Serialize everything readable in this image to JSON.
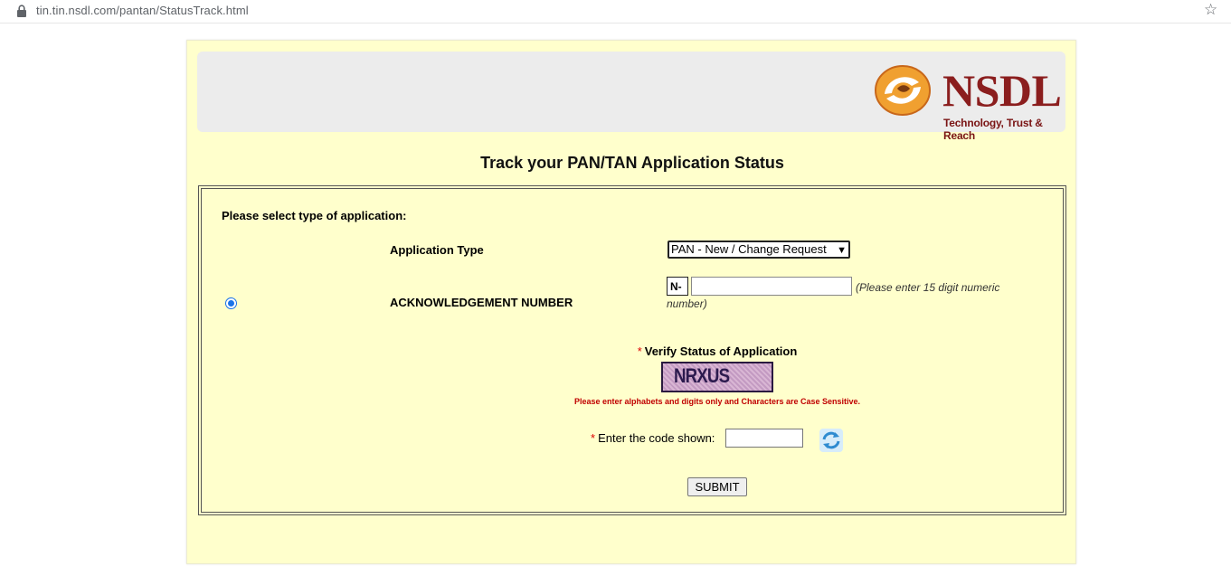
{
  "browser": {
    "url": "tin.tin.nsdl.com/pantan/StatusTrack.html",
    "lock_icon": "lock-icon",
    "star_icon": "star-icon"
  },
  "header": {
    "logo_text": "NSDL",
    "tagline": "Technology, Trust & Reach",
    "logo_icon": "nsdl-logo-mark"
  },
  "page_title": "Track your PAN/TAN Application Status",
  "form": {
    "select_type_label": "Please select type of application:",
    "application_type_label": "Application Type",
    "application_type_value": "PAN - New / Change Request",
    "ack_label": "ACKNOWLEDGEMENT NUMBER",
    "ack_prefix": "N-",
    "ack_value": "",
    "ack_hint": "(Please enter 15 digit numeric number)",
    "radio_selected": true,
    "required_mark": "*",
    "verify_label": "Verify Status of Application",
    "captcha_text": "NRXUS",
    "case_note": "Please enter alphabets and digits only and Characters are Case Sensitive.",
    "code_label": "Enter the code shown:",
    "code_value": "",
    "submit_label": "SUBMIT"
  },
  "colors": {
    "panel_bg": "#ffffcc",
    "brand_red": "#8b1e1e",
    "warning_red": "#c00000",
    "radio_blue": "#1a73e8"
  }
}
